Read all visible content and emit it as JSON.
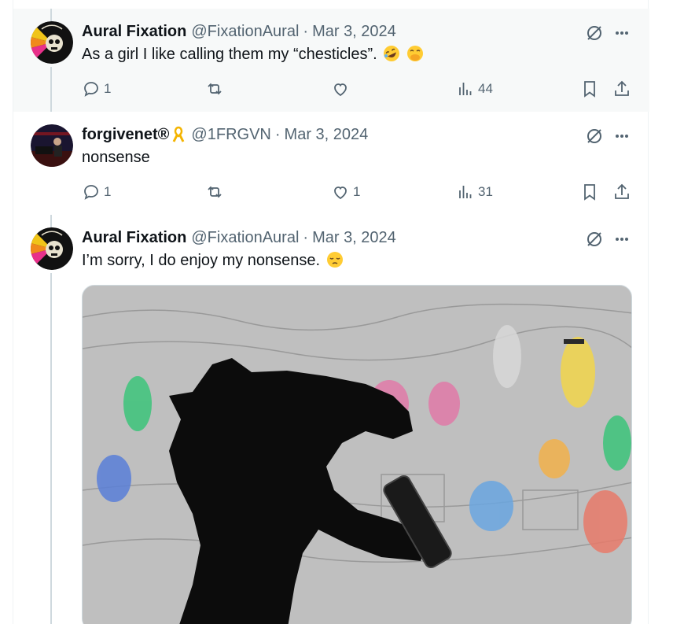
{
  "tweets": [
    {
      "author_name": "Aural Fixation",
      "handle": "@FixationAural",
      "separator": "·",
      "date": "Mar 3, 2024",
      "text": "As a girl I like calling them my “chesticles”.",
      "emojis": [
        "rolling-on-floor-laughing",
        "face-with-hand-over-mouth"
      ],
      "stats": {
        "replies": "1",
        "reposts": "",
        "likes": "",
        "views": "44"
      }
    },
    {
      "author_name": "forgivenet®",
      "badge": "yellow-ribbon",
      "handle": "@1FRGVN",
      "separator": "·",
      "date": "Mar 3, 2024",
      "text": "nonsense",
      "stats": {
        "replies": "1",
        "reposts": "",
        "likes": "1",
        "views": "31"
      }
    },
    {
      "author_name": "Aural Fixation",
      "handle": "@FixationAural",
      "separator": "·",
      "date": "Mar 3, 2024",
      "text": "I’m sorry, I do enjoy my nonsense.",
      "emojis": [
        "pensive-face"
      ],
      "media": "animated image: black horse silhouette drinking from a bottle over a sketched crowd background"
    }
  ],
  "colors": {
    "text_primary": "#0f1419",
    "text_secondary": "#536471",
    "highlight_bg": "#f7f9f9",
    "thread_line": "#cfd9de"
  },
  "icons": [
    "reply-icon",
    "repost-icon",
    "like-icon",
    "views-icon",
    "bookmark-icon",
    "share-icon",
    "grok-icon",
    "more-icon"
  ]
}
